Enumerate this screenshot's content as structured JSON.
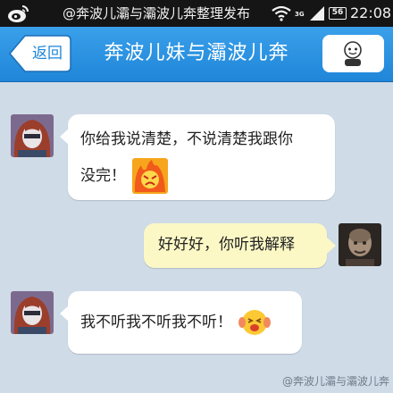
{
  "status_bar": {
    "title": "@奔波儿灞与灞波儿奔整理发布",
    "network": "3G",
    "battery": "56",
    "time": "22:08"
  },
  "header": {
    "back_label": "返回",
    "title": "奔波儿妹与灞波儿奔",
    "profile_icon": "person-icon"
  },
  "messages": [
    {
      "direction": "incoming",
      "line1": "你给我说清楚，不说清楚我跟你",
      "line2": "没完！",
      "emoji": "angry-fire-emoji"
    },
    {
      "direction": "outgoing",
      "text": "好好好，你听我解释"
    },
    {
      "direction": "incoming",
      "text": "我不听我不听我不听！",
      "emoji": "covering-ears-emoji"
    }
  ],
  "watermark": "@奔波儿灞与灞波儿奔",
  "colors": {
    "header_blue": "#1f86d9",
    "incoming_bubble": "#ffffff",
    "outgoing_bubble": "#fbf8c6",
    "chat_bg": "#cfdbe7"
  }
}
